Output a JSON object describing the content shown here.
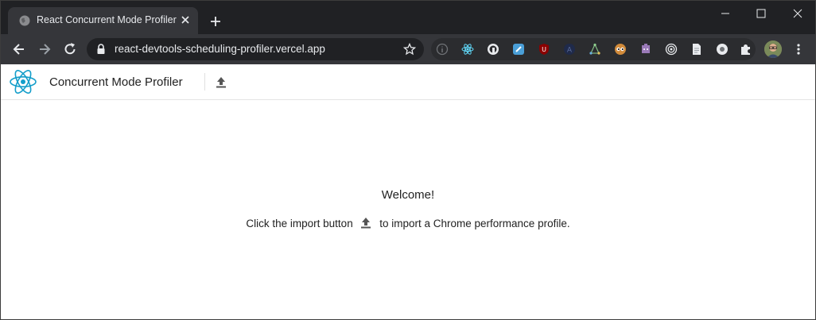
{
  "browser": {
    "tab": {
      "title": "React Concurrent Mode Profiler",
      "favicon": "globe-icon"
    },
    "new_tab_icon": "plus-icon",
    "window_controls": [
      "minimize-icon",
      "maximize-icon",
      "close-icon"
    ],
    "url": "react-devtools-scheduling-profiler.vercel.app",
    "extensions": [
      "info-icon",
      "react-devtools-icon",
      "password-manager-icon",
      "pen-icon",
      "ublock-icon",
      "circle-a-icon",
      "network-icon",
      "cartoon-eyes-icon",
      "puzzle-character-icon",
      "target-icon",
      "document-icon",
      "disc-icon",
      "extensions-puzzle-icon"
    ],
    "colors": {
      "frame": "#202124",
      "toolbar": "#35363a",
      "text": "#e8eaed"
    }
  },
  "app": {
    "title": "Concurrent Mode Profiler",
    "logo": "react-logo-icon",
    "import_icon": "upload-icon",
    "accent": "#61dafb",
    "welcome": "Welcome!",
    "instructions_before": "Click the import button",
    "instructions_after": "to import a Chrome performance profile."
  }
}
